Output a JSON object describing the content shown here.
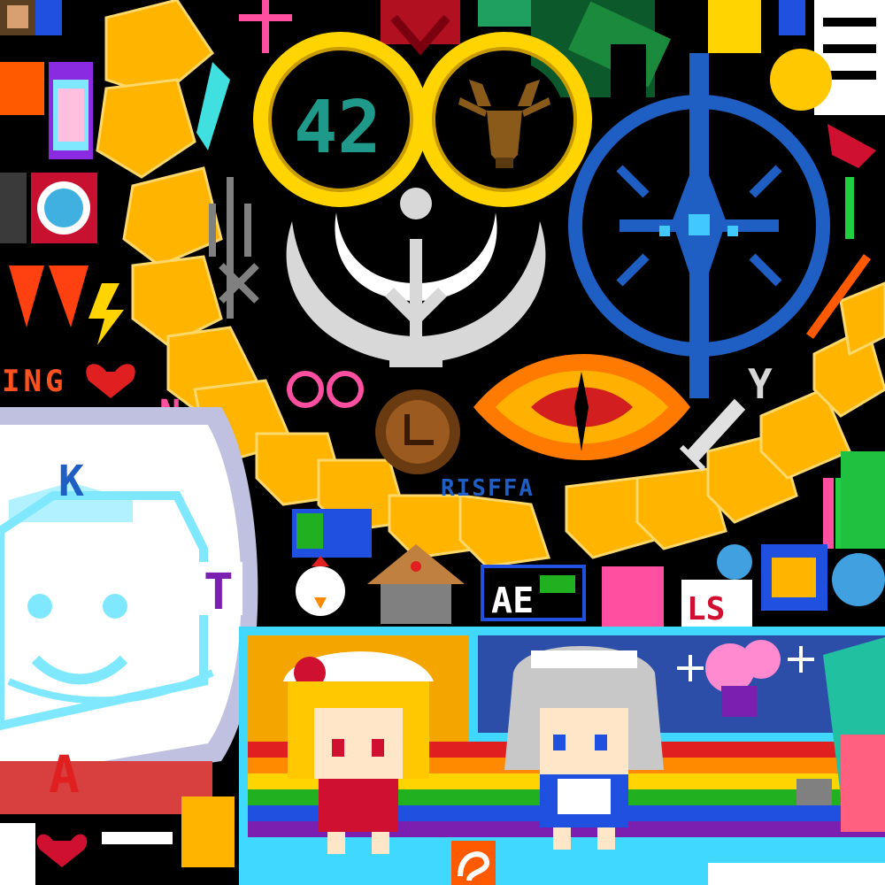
{
  "texts": {
    "num": "42",
    "ing": "ING",
    "letter_k": "K",
    "letter_t": "T",
    "letter_a": "A",
    "risffa": "RISFFA",
    "ae": "AE",
    "ls": "LS",
    "n": "N"
  },
  "colors": {
    "background": "#000000",
    "gold_ring": "#ffd400",
    "gold_ring_dark": "#c89b00",
    "dragon_tile": "#ffb400",
    "dragon_tile_light": "#ffd86b",
    "blue_emblem": "#1f5fc4",
    "silver": "#d8d8d8",
    "eye_orange": "#ff7a00",
    "eye_red": "#d21e1e",
    "cyan": "#7fe8ff",
    "rainbow": [
      "#e02020",
      "#ff8a00",
      "#ffd400",
      "#20b020",
      "#2050e0",
      "#7a1fb0"
    ],
    "panel_orange": "#f4a500",
    "panel_blue": "#2c4ea8",
    "panel_frame": "#40d8ff",
    "cat_bg": "#ffffff"
  },
  "icons": [
    "deer-head-icon",
    "crescent-sun-emblem-icon",
    "blue-compass-emblem-icon",
    "eye-of-sauron-icon",
    "heart-icon",
    "sword-icon",
    "house-icon",
    "chicken-icon"
  ]
}
